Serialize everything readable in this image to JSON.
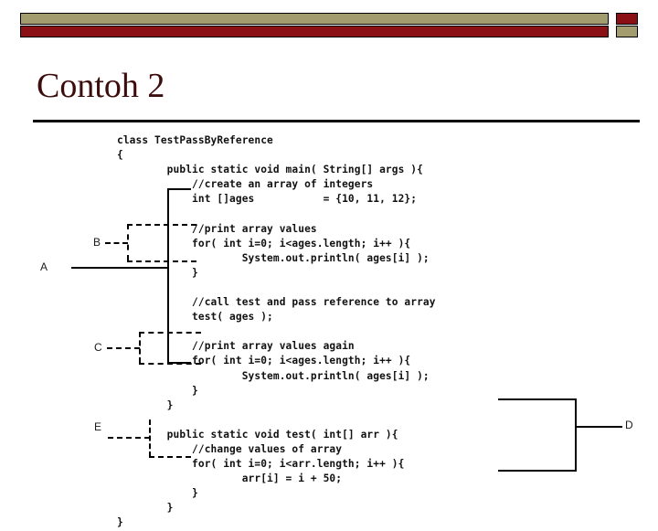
{
  "slide": {
    "title": "Contoh 2",
    "title_color": "#3d0c0c",
    "header": {
      "top_bar_color": "#a39c6e",
      "top_square_color": "#8b1016",
      "bottom_bar_color": "#8b1016",
      "bottom_square_color": "#a39c6e",
      "outline_color": "#000000"
    }
  },
  "code": {
    "language": "java",
    "lines": [
      "class TestPassByReference",
      "{",
      "        public static void main( String[] args ){",
      "            //create an array of integers",
      "            int []ages           = {10, 11, 12};",
      "",
      "            //print array values",
      "            for( int i=0; i<ages.length; i++ ){",
      "                    System.out.println( ages[i] );",
      "            }",
      "",
      "            //call test and pass reference to array",
      "            test( ages );",
      "",
      "            //print array values again",
      "            for( int i=0; i<ages.length; i++ ){",
      "                    System.out.println( ages[i] );",
      "            }",
      "        }",
      "",
      "        public static void test( int[] arr ){",
      "            //change values of array",
      "            for( int i=0; i<arr.length; i++ ){",
      "                    arr[i] = i + 50;",
      "            }",
      "        }",
      "}"
    ]
  },
  "annotations": {
    "labels": [
      {
        "id": "A",
        "text": "A",
        "style": "solid",
        "target": "main-method-body"
      },
      {
        "id": "B",
        "text": "B",
        "style": "dashed",
        "target": "first-print-loop"
      },
      {
        "id": "C",
        "text": "C",
        "style": "dashed",
        "target": "second-print-loop"
      },
      {
        "id": "D",
        "text": "D",
        "style": "solid",
        "target": "test-method"
      },
      {
        "id": "E",
        "text": "E",
        "style": "dashed",
        "target": "change-values-loop"
      }
    ]
  }
}
